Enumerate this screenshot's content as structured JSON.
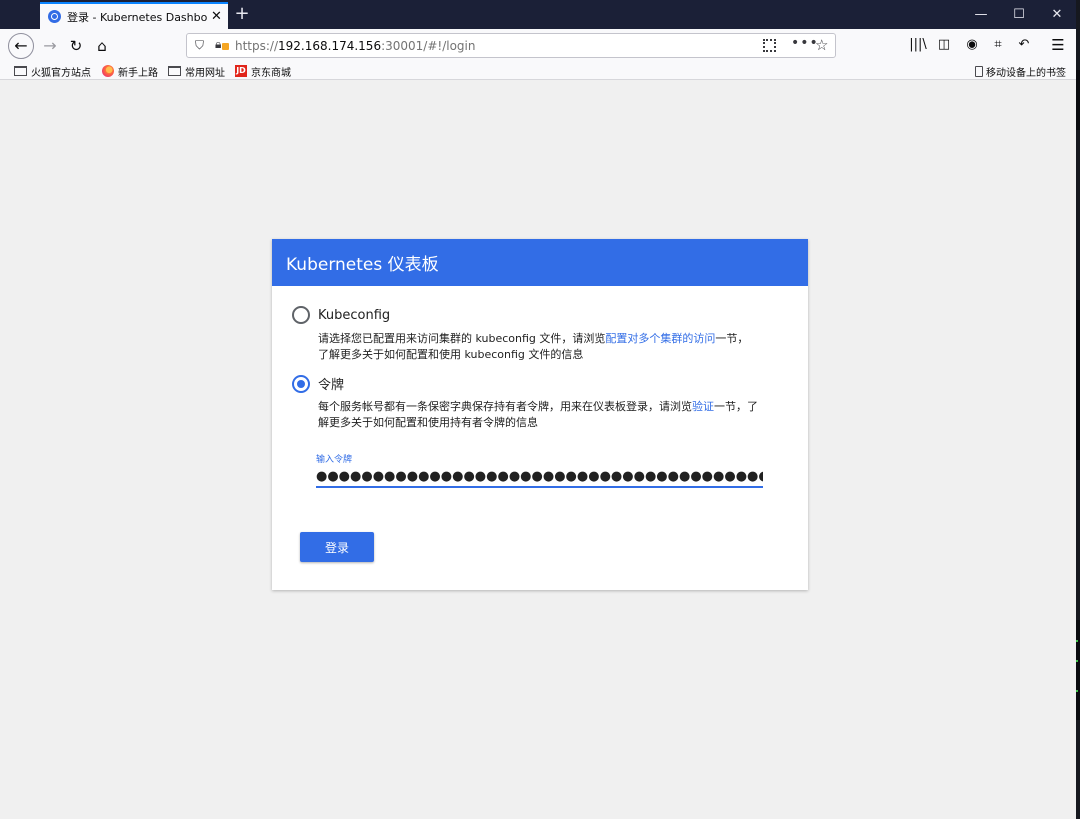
{
  "browser": {
    "tab": {
      "title": "登录 - Kubernetes Dashboard",
      "close": "✕"
    },
    "new_tab": "+",
    "window_controls": {
      "minimize": "—",
      "maximize": "☐",
      "close": "✕"
    },
    "url": {
      "scheme": "https://",
      "host": "192.168.174.156",
      "rest": ":30001/#!/login"
    },
    "bookmarks": [
      {
        "label": "火狐官方站点",
        "icon": "folder-icon"
      },
      {
        "label": "新手上路",
        "icon": "firefox-icon"
      },
      {
        "label": "常用网址",
        "icon": "folder-icon"
      },
      {
        "label": "京东商城",
        "icon": "jd-icon",
        "icon_text": "JD"
      }
    ],
    "mobile_bookmarks": "移动设备上的书签"
  },
  "login": {
    "title": "Kubernetes 仪表板",
    "kubeconfig": {
      "label": "Kubeconfig",
      "desc_before": "请选择您已配置用来访问集群的 kubeconfig 文件，请浏览",
      "desc_link": "配置对多个集群的访问",
      "desc_after": "一节，了解更多关于如何配置和使用 kubeconfig 文件的信息",
      "selected": false
    },
    "token": {
      "label": "令牌",
      "desc_before": "每个服务帐号都有一条保密字典保存持有者令牌，用来在仪表板登录，请浏览",
      "desc_link": "验证",
      "desc_after": "一节，了解更多关于如何配置和使用持有者令牌的信息",
      "selected": true
    },
    "field_label": "输入令牌",
    "token_value": "●●●●●●●●●●●●●●●●●●●●●●●●●●●●●●●●●●●●●●●●●●●●●●●●●●●●●●",
    "submit": "登录"
  },
  "colors": {
    "accent": "#326de6",
    "titlebar": "#1b2037"
  }
}
